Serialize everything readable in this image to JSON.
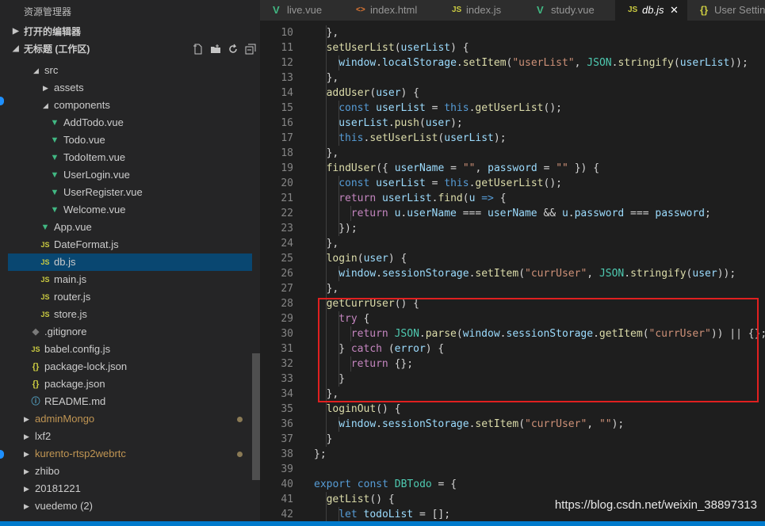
{
  "sidebar": {
    "title": "资源管理器",
    "open_editors": "打开的编辑器",
    "workspace": "无标题 (工作区)",
    "actions": [
      "new-file-icon",
      "new-folder-icon",
      "refresh-icon",
      "collapse-all-icon"
    ],
    "tree": [
      {
        "name": "src",
        "type": "folder-open"
      },
      {
        "name": "assets",
        "type": "folder"
      },
      {
        "name": "components",
        "type": "folder-open"
      },
      {
        "name": "AddTodo.vue",
        "type": "vue"
      },
      {
        "name": "Todo.vue",
        "type": "vue"
      },
      {
        "name": "TodoItem.vue",
        "type": "vue"
      },
      {
        "name": "UserLogin.vue",
        "type": "vue"
      },
      {
        "name": "UserRegister.vue",
        "type": "vue"
      },
      {
        "name": "Welcome.vue",
        "type": "vue"
      },
      {
        "name": "App.vue",
        "type": "vue"
      },
      {
        "name": "DateFormat.js",
        "type": "js"
      },
      {
        "name": "db.js",
        "type": "js",
        "selected": true
      },
      {
        "name": "main.js",
        "type": "js"
      },
      {
        "name": "router.js",
        "type": "js"
      },
      {
        "name": "store.js",
        "type": "js"
      },
      {
        "name": ".gitignore",
        "type": "git"
      },
      {
        "name": "babel.config.js",
        "type": "js"
      },
      {
        "name": "package-lock.json",
        "type": "json"
      },
      {
        "name": "package.json",
        "type": "json"
      },
      {
        "name": "README.md",
        "type": "info"
      },
      {
        "name": "adminMongo",
        "type": "folder",
        "modified": true
      },
      {
        "name": "lxf2",
        "type": "folder"
      },
      {
        "name": "kurento-rtsp2webrtc",
        "type": "folder",
        "modified": true
      },
      {
        "name": "zhibo",
        "type": "folder"
      },
      {
        "name": "20181221",
        "type": "folder"
      },
      {
        "name": "vuedemo (2)",
        "type": "folder"
      }
    ]
  },
  "tabs": [
    {
      "label": "live.vue",
      "icon": "vue"
    },
    {
      "label": "index.html",
      "icon": "html"
    },
    {
      "label": "index.js",
      "icon": "js"
    },
    {
      "label": "study.vue",
      "icon": "vue"
    },
    {
      "label": "db.js",
      "icon": "js",
      "active": true
    },
    {
      "label": "User Settings",
      "icon": "json"
    }
  ],
  "icons": {
    "vue": "V",
    "js": "JS",
    "html": "<>",
    "json": "{}",
    "close": "✕"
  },
  "code_lines": [
    {
      "n": "10",
      "indent": 1,
      "tokens": [
        [
          "p",
          "},"
        ]
      ]
    },
    {
      "n": "11",
      "indent": 1,
      "tokens": [
        [
          "f",
          "setUserList"
        ],
        [
          "p",
          "("
        ],
        [
          "v",
          "userList"
        ],
        [
          "p",
          ") {"
        ]
      ]
    },
    {
      "n": "12",
      "indent": 2,
      "tokens": [
        [
          "v",
          "window"
        ],
        [
          "p",
          "."
        ],
        [
          "v",
          "localStorage"
        ],
        [
          "p",
          "."
        ],
        [
          "f",
          "setItem"
        ],
        [
          "p",
          "("
        ],
        [
          "s",
          "\"userList\""
        ],
        [
          "p",
          ", "
        ],
        [
          "c",
          "JSON"
        ],
        [
          "p",
          "."
        ],
        [
          "f",
          "stringify"
        ],
        [
          "p",
          "("
        ],
        [
          "v",
          "userList"
        ],
        [
          "p",
          "));"
        ]
      ]
    },
    {
      "n": "13",
      "indent": 1,
      "tokens": [
        [
          "p",
          "},"
        ]
      ]
    },
    {
      "n": "14",
      "indent": 1,
      "tokens": [
        [
          "f",
          "addUser"
        ],
        [
          "p",
          "("
        ],
        [
          "v",
          "user"
        ],
        [
          "p",
          ") {"
        ]
      ]
    },
    {
      "n": "15",
      "indent": 2,
      "tokens": [
        [
          "k",
          "const "
        ],
        [
          "v",
          "userList"
        ],
        [
          "p",
          " = "
        ],
        [
          "k",
          "this"
        ],
        [
          "p",
          "."
        ],
        [
          "f",
          "getUserList"
        ],
        [
          "p",
          "();"
        ]
      ]
    },
    {
      "n": "16",
      "indent": 2,
      "tokens": [
        [
          "v",
          "userList"
        ],
        [
          "p",
          "."
        ],
        [
          "f",
          "push"
        ],
        [
          "p",
          "("
        ],
        [
          "v",
          "user"
        ],
        [
          "p",
          ");"
        ]
      ]
    },
    {
      "n": "17",
      "indent": 2,
      "tokens": [
        [
          "k",
          "this"
        ],
        [
          "p",
          "."
        ],
        [
          "f",
          "setUserList"
        ],
        [
          "p",
          "("
        ],
        [
          "v",
          "userList"
        ],
        [
          "p",
          ");"
        ]
      ]
    },
    {
      "n": "18",
      "indent": 1,
      "tokens": [
        [
          "p",
          "},"
        ]
      ]
    },
    {
      "n": "19",
      "indent": 1,
      "tokens": [
        [
          "f",
          "findUser"
        ],
        [
          "p",
          "({ "
        ],
        [
          "v",
          "userName"
        ],
        [
          "p",
          " = "
        ],
        [
          "s",
          "\"\""
        ],
        [
          "p",
          ", "
        ],
        [
          "v",
          "password"
        ],
        [
          "p",
          " = "
        ],
        [
          "s",
          "\"\""
        ],
        [
          "p",
          " }) {"
        ]
      ]
    },
    {
      "n": "20",
      "indent": 2,
      "tokens": [
        [
          "k",
          "const "
        ],
        [
          "v",
          "userList"
        ],
        [
          "p",
          " = "
        ],
        [
          "k",
          "this"
        ],
        [
          "p",
          "."
        ],
        [
          "f",
          "getUserList"
        ],
        [
          "p",
          "();"
        ]
      ]
    },
    {
      "n": "21",
      "indent": 2,
      "tokens": [
        [
          "kc",
          "return "
        ],
        [
          "v",
          "userList"
        ],
        [
          "p",
          "."
        ],
        [
          "f",
          "find"
        ],
        [
          "p",
          "("
        ],
        [
          "v",
          "u"
        ],
        [
          "k",
          " => "
        ],
        [
          "p",
          "{"
        ]
      ]
    },
    {
      "n": "22",
      "indent": 3,
      "tokens": [
        [
          "kc",
          "return "
        ],
        [
          "v",
          "u"
        ],
        [
          "p",
          "."
        ],
        [
          "v",
          "userName"
        ],
        [
          "p",
          " === "
        ],
        [
          "v",
          "userName"
        ],
        [
          "p",
          " && "
        ],
        [
          "v",
          "u"
        ],
        [
          "p",
          "."
        ],
        [
          "v",
          "password"
        ],
        [
          "p",
          " === "
        ],
        [
          "v",
          "password"
        ],
        [
          "p",
          ";"
        ]
      ]
    },
    {
      "n": "23",
      "indent": 2,
      "tokens": [
        [
          "p",
          "});"
        ]
      ]
    },
    {
      "n": "24",
      "indent": 1,
      "tokens": [
        [
          "p",
          "},"
        ]
      ]
    },
    {
      "n": "25",
      "indent": 1,
      "tokens": [
        [
          "f",
          "login"
        ],
        [
          "p",
          "("
        ],
        [
          "v",
          "user"
        ],
        [
          "p",
          ") {"
        ]
      ]
    },
    {
      "n": "26",
      "indent": 2,
      "tokens": [
        [
          "v",
          "window"
        ],
        [
          "p",
          "."
        ],
        [
          "v",
          "sessionStorage"
        ],
        [
          "p",
          "."
        ],
        [
          "f",
          "setItem"
        ],
        [
          "p",
          "("
        ],
        [
          "s",
          "\"currUser\""
        ],
        [
          "p",
          ", "
        ],
        [
          "c",
          "JSON"
        ],
        [
          "p",
          "."
        ],
        [
          "f",
          "stringify"
        ],
        [
          "p",
          "("
        ],
        [
          "v",
          "user"
        ],
        [
          "p",
          "));"
        ]
      ]
    },
    {
      "n": "27",
      "indent": 1,
      "tokens": [
        [
          "p",
          "},"
        ]
      ]
    },
    {
      "n": "28",
      "indent": 1,
      "tokens": [
        [
          "f",
          "getCurrUser"
        ],
        [
          "p",
          "() {"
        ]
      ]
    },
    {
      "n": "29",
      "indent": 2,
      "tokens": [
        [
          "kc",
          "try "
        ],
        [
          "p",
          "{"
        ]
      ]
    },
    {
      "n": "30",
      "indent": 3,
      "tokens": [
        [
          "kc",
          "return "
        ],
        [
          "c",
          "JSON"
        ],
        [
          "p",
          "."
        ],
        [
          "f",
          "parse"
        ],
        [
          "p",
          "("
        ],
        [
          "v",
          "window"
        ],
        [
          "p",
          "."
        ],
        [
          "v",
          "sessionStorage"
        ],
        [
          "p",
          "."
        ],
        [
          "f",
          "getItem"
        ],
        [
          "p",
          "("
        ],
        [
          "s",
          "\"currUser\""
        ],
        [
          "p",
          ")) || {};"
        ]
      ]
    },
    {
      "n": "31",
      "indent": 2,
      "tokens": [
        [
          "p",
          "} "
        ],
        [
          "kc",
          "catch "
        ],
        [
          "p",
          "("
        ],
        [
          "v",
          "error"
        ],
        [
          "p",
          ") {"
        ]
      ]
    },
    {
      "n": "32",
      "indent": 3,
      "tokens": [
        [
          "kc",
          "return "
        ],
        [
          "p",
          "{};"
        ]
      ]
    },
    {
      "n": "33",
      "indent": 2,
      "tokens": [
        [
          "p",
          "}"
        ]
      ]
    },
    {
      "n": "34",
      "indent": 1,
      "tokens": [
        [
          "p",
          "},"
        ]
      ]
    },
    {
      "n": "35",
      "indent": 1,
      "tokens": [
        [
          "f",
          "loginOut"
        ],
        [
          "p",
          "() {"
        ]
      ]
    },
    {
      "n": "36",
      "indent": 2,
      "tokens": [
        [
          "v",
          "window"
        ],
        [
          "p",
          "."
        ],
        [
          "v",
          "sessionStorage"
        ],
        [
          "p",
          "."
        ],
        [
          "f",
          "setItem"
        ],
        [
          "p",
          "("
        ],
        [
          "s",
          "\"currUser\""
        ],
        [
          "p",
          ", "
        ],
        [
          "s",
          "\"\""
        ],
        [
          "p",
          ");"
        ]
      ]
    },
    {
      "n": "37",
      "indent": 1,
      "tokens": [
        [
          "p",
          "}"
        ]
      ]
    },
    {
      "n": "38",
      "indent": 0,
      "tokens": [
        [
          "p",
          "};"
        ]
      ]
    },
    {
      "n": "39",
      "indent": 0,
      "tokens": []
    },
    {
      "n": "40",
      "indent": 0,
      "tokens": [
        [
          "k",
          "export "
        ],
        [
          "k",
          "const "
        ],
        [
          "c",
          "DBTodo"
        ],
        [
          "p",
          " = {"
        ]
      ]
    },
    {
      "n": "41",
      "indent": 1,
      "tokens": [
        [
          "f",
          "getList"
        ],
        [
          "p",
          "() {"
        ]
      ]
    },
    {
      "n": "42",
      "indent": 2,
      "tokens": [
        [
          "k",
          "let "
        ],
        [
          "v",
          "todoList"
        ],
        [
          "p",
          " = [];"
        ]
      ]
    }
  ],
  "watermark": "https://blog.csdn.net/weixin_38897313",
  "colors": {
    "highlight_box": "#e02020",
    "selection": "#094771",
    "status": "#007acc",
    "vue": "#41b883",
    "js": "#cbcb41"
  }
}
